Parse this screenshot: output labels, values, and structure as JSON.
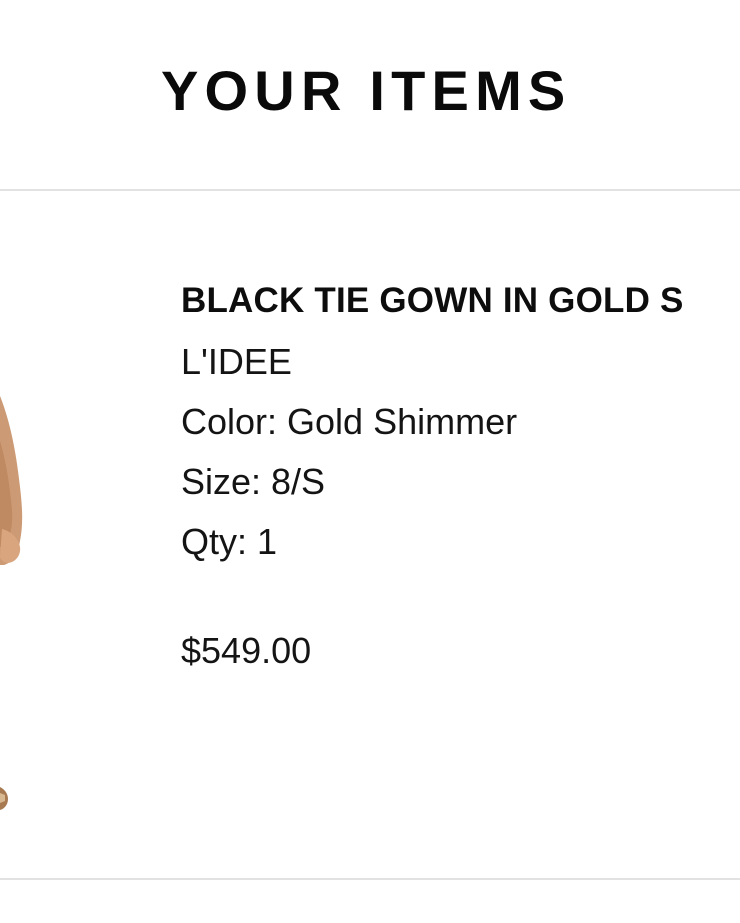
{
  "header": {
    "title": "YOUR ITEMS"
  },
  "items": [
    {
      "name": "BLACK TIE GOWN IN GOLD S",
      "brand": "L'IDEE",
      "color": "Color: Gold Shimmer",
      "size": "Size: 8/S",
      "qty": "Qty: 1",
      "price": "$549.00"
    }
  ],
  "colors": {
    "text": "#111111",
    "divider": "#e2e2e2",
    "background": "#ffffff",
    "skin_tone": "#c8926a"
  }
}
